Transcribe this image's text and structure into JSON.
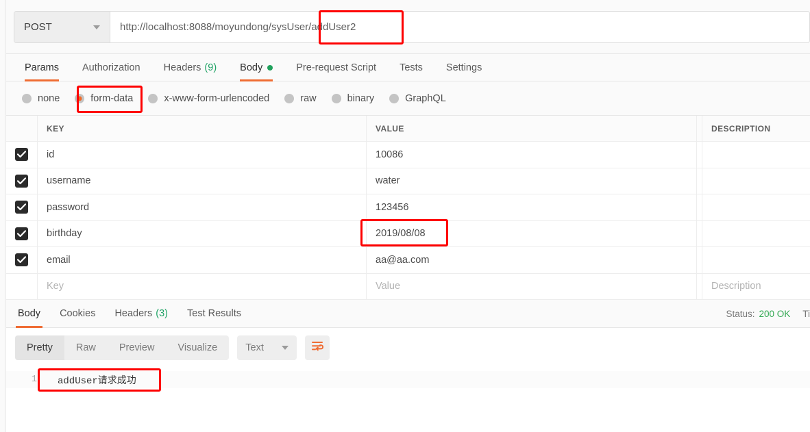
{
  "request": {
    "method": "POST",
    "url": "http://localhost:8088/moyundong/sysUser/addUser2",
    "tabs": [
      {
        "label": "Params",
        "count": "",
        "active": false,
        "dot": false
      },
      {
        "label": "Authorization",
        "count": "",
        "active": false,
        "dot": false
      },
      {
        "label": "Headers",
        "count": "(9)",
        "active": false,
        "dot": false
      },
      {
        "label": "Body",
        "count": "",
        "active": true,
        "dot": true
      },
      {
        "label": "Pre-request Script",
        "count": "",
        "active": false,
        "dot": false
      },
      {
        "label": "Tests",
        "count": "",
        "active": false,
        "dot": false
      },
      {
        "label": "Settings",
        "count": "",
        "active": false,
        "dot": false
      }
    ],
    "body_types": [
      {
        "label": "none",
        "selected": false
      },
      {
        "label": "form-data",
        "selected": true
      },
      {
        "label": "x-www-form-urlencoded",
        "selected": false
      },
      {
        "label": "raw",
        "selected": false
      },
      {
        "label": "binary",
        "selected": false
      },
      {
        "label": "GraphQL",
        "selected": false
      }
    ]
  },
  "form_table": {
    "headers": {
      "key": "KEY",
      "value": "VALUE",
      "description": "DESCRIPTION"
    },
    "rows": [
      {
        "checked": true,
        "key": "id",
        "value": "10086",
        "description": ""
      },
      {
        "checked": true,
        "key": "username",
        "value": "water",
        "description": ""
      },
      {
        "checked": true,
        "key": "password",
        "value": "123456",
        "description": ""
      },
      {
        "checked": true,
        "key": "birthday",
        "value": "2019/08/08",
        "description": ""
      },
      {
        "checked": true,
        "key": "email",
        "value": "aa@aa.com",
        "description": ""
      }
    ],
    "placeholder_row": {
      "key": "Key",
      "value": "Value",
      "description": "Description"
    }
  },
  "response": {
    "tabs": [
      {
        "label": "Body",
        "count": "",
        "active": true
      },
      {
        "label": "Cookies",
        "count": "",
        "active": false
      },
      {
        "label": "Headers",
        "count": "(3)",
        "active": false
      },
      {
        "label": "Test Results",
        "count": "",
        "active": false
      }
    ],
    "status_label": "Status:",
    "status_value": "200 OK",
    "time_label": "Ti",
    "view_modes": [
      {
        "label": "Pretty",
        "active": true
      },
      {
        "label": "Raw",
        "active": false
      },
      {
        "label": "Preview",
        "active": false
      },
      {
        "label": "Visualize",
        "active": false
      }
    ],
    "format": "Text",
    "wrap_icon": "word-wrap-icon",
    "body_line_number": "1",
    "body_text": "addUser请求成功"
  },
  "colors": {
    "accent": "#ef6c33",
    "green": "#21a366",
    "annotation": "#fe0000",
    "checkbox": "#2b2b2b"
  }
}
